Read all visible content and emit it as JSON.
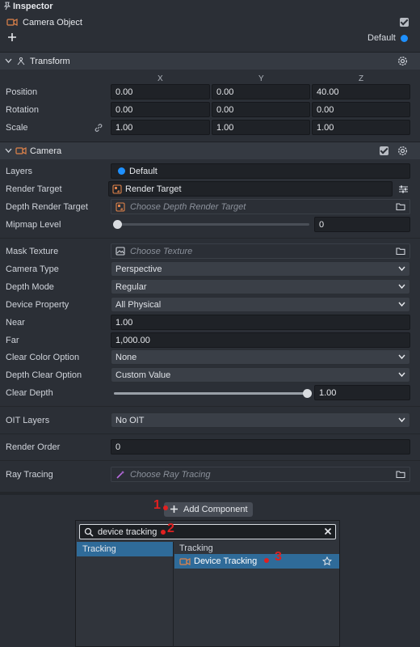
{
  "inspector": {
    "title": "Inspector",
    "object_name": "Camera Object",
    "layer_label": "Default"
  },
  "transform": {
    "title": "Transform",
    "axes": [
      "X",
      "Y",
      "Z"
    ],
    "rows": [
      {
        "label": "Position",
        "values": [
          "0.00",
          "0.00",
          "40.00"
        ]
      },
      {
        "label": "Rotation",
        "values": [
          "0.00",
          "0.00",
          "0.00"
        ]
      },
      {
        "label": "Scale",
        "values": [
          "1.00",
          "1.00",
          "1.00"
        ]
      }
    ]
  },
  "camera": {
    "title": "Camera",
    "layers_label": "Layers",
    "layers_value": "Default",
    "render_target_label": "Render Target",
    "render_target_value": "Render Target",
    "depth_render_target_label": "Depth Render Target",
    "depth_render_target_placeholder": "Choose Depth Render Target",
    "mipmap_label": "Mipmap Level",
    "mipmap_value": "0",
    "mipmap_fraction": 0,
    "mask_texture_label": "Mask Texture",
    "mask_texture_placeholder": "Choose Texture",
    "camera_type_label": "Camera Type",
    "camera_type_value": "Perspective",
    "depth_mode_label": "Depth Mode",
    "depth_mode_value": "Regular",
    "device_property_label": "Device Property",
    "device_property_value": "All Physical",
    "near_label": "Near",
    "near_value": "1.00",
    "far_label": "Far",
    "far_value": "1,000.00",
    "clear_color_label": "Clear Color Option",
    "clear_color_value": "None",
    "depth_clear_label": "Depth Clear Option",
    "depth_clear_value": "Custom Value",
    "clear_depth_label": "Clear Depth",
    "clear_depth_value": "1.00",
    "clear_depth_fraction": 1,
    "oit_label": "OIT Layers",
    "oit_value": "No OIT",
    "render_order_label": "Render Order",
    "render_order_value": "0",
    "ray_tracing_label": "Ray Tracing",
    "ray_tracing_placeholder": "Choose Ray Tracing"
  },
  "add_component": {
    "button_label": "Add Component",
    "search_value": "device tracking",
    "categories": [
      "Tracking"
    ],
    "results_header": "Tracking",
    "results": [
      "Device Tracking"
    ]
  },
  "annotations": [
    "1",
    "2",
    "3"
  ],
  "colors": {
    "panel_bg": "#2b2f36",
    "field_bg": "#1f2227",
    "accent_blue": "#1e90ff",
    "selection_blue": "#2f6b99",
    "camera_orange": "#e0834a",
    "annotation_red": "#e02020"
  }
}
